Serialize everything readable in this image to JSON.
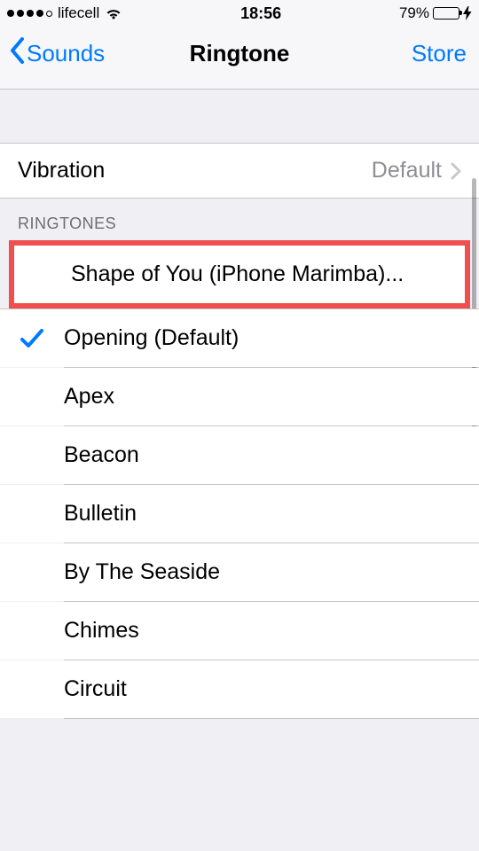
{
  "status": {
    "carrier": "lifecell",
    "time": "18:56",
    "battery_pct": "79%"
  },
  "nav": {
    "back_label": "Sounds",
    "title": "Ringtone",
    "right_label": "Store"
  },
  "vibration": {
    "label": "Vibration",
    "value": "Default"
  },
  "sections": {
    "ringtones_header": "RINGTONES"
  },
  "ringtones": {
    "highlighted": "Shape of You (iPhone Marimba)...",
    "items": [
      {
        "label": "Opening (Default)",
        "selected": true
      },
      {
        "label": "Apex",
        "selected": false
      },
      {
        "label": "Beacon",
        "selected": false
      },
      {
        "label": "Bulletin",
        "selected": false
      },
      {
        "label": "By The Seaside",
        "selected": false
      },
      {
        "label": "Chimes",
        "selected": false
      },
      {
        "label": "Circuit",
        "selected": false
      }
    ]
  }
}
